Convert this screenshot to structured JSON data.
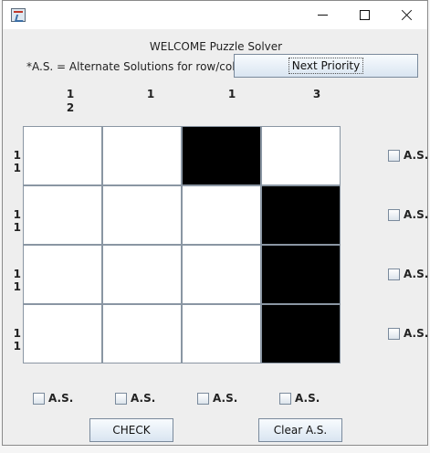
{
  "puzzle": {
    "welcome": "WELCOME Puzzle Solver",
    "note": "*A.S. = Alternate Solutions for row/col",
    "next_button": "Next Priority",
    "check_button": "CHECK",
    "clear_button": "Clear A.S.",
    "as_label": "A.S.",
    "column_clues": [
      {
        "line1": "1",
        "line2": "2"
      },
      {
        "line1": "",
        "line2": "1"
      },
      {
        "line1": "",
        "line2": "1"
      },
      {
        "line1": "",
        "line2": "3"
      }
    ],
    "row_clues": [
      "1 1",
      "1 1",
      "1 1",
      "1 1"
    ],
    "grid": [
      [
        0,
        0,
        1,
        0
      ],
      [
        0,
        0,
        0,
        1
      ],
      [
        0,
        0,
        0,
        1
      ],
      [
        0,
        0,
        0,
        1
      ]
    ],
    "colors": {
      "filled": "#000000",
      "empty": "#ffffff"
    }
  }
}
